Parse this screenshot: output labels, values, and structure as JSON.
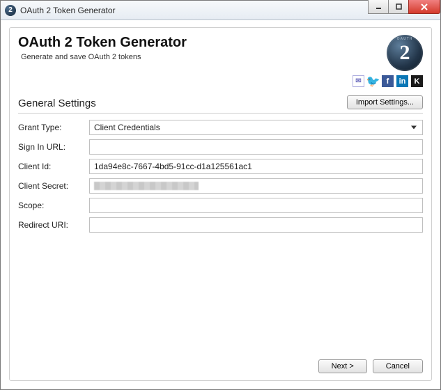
{
  "window": {
    "title": "OAuth 2 Token Generator",
    "icon_text": "2"
  },
  "header": {
    "title": "OAuth 2 Token Generator",
    "subtitle": "Generate and save OAuth 2 tokens",
    "logo_text": "2"
  },
  "social": {
    "email": "✉",
    "twitter": "🐦",
    "facebook": "f",
    "linkedin": "in",
    "k": "K"
  },
  "section": {
    "title": "General Settings",
    "import_button": "Import Settings..."
  },
  "form": {
    "grant_type": {
      "label": "Grant Type:",
      "value": "Client Credentials"
    },
    "signin_url": {
      "label": "Sign In URL:",
      "value": ""
    },
    "client_id": {
      "label": "Client Id:",
      "value": "1da94e8c-7667-4bd5-91cc-d1a125561ac1"
    },
    "client_secret": {
      "label": "Client Secret:",
      "value": ""
    },
    "scope": {
      "label": "Scope:",
      "value": ""
    },
    "redirect_uri": {
      "label": "Redirect URI:",
      "value": ""
    }
  },
  "footer": {
    "next": "Next >",
    "cancel": "Cancel"
  }
}
